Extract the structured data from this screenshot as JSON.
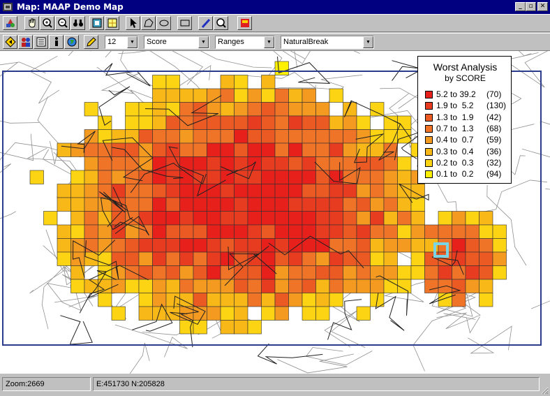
{
  "window": {
    "title": "Map: MAAP Demo Map",
    "minimize": "_",
    "restore": "▫",
    "close": "✕"
  },
  "toolbar1": {
    "icons": [
      "layers-icon",
      "hand-pan-icon",
      "zoom-in-icon",
      "zoom-out-icon",
      "binoculars-icon",
      "map-extent-icon",
      "grid-icon",
      "pointer-icon",
      "polygon-icon",
      "ellipse-icon",
      "rectangle-icon",
      "pen-icon",
      "magnify-icon",
      "flag-icon"
    ]
  },
  "toolbar2": {
    "icons": [
      "navigate-icon",
      "people-icon",
      "list-icon",
      "info-icon",
      "globe-icon",
      "pencil-icon"
    ],
    "combo_count": "12",
    "combo_field": "Score",
    "combo_method": "Ranges",
    "combo_break": "NaturalBreak"
  },
  "legend": {
    "title": "Worst Analysis",
    "subtitle": "by SCORE",
    "items": [
      {
        "range": "5.2 to 39.2",
        "count": "(70)",
        "color": "#e8201c"
      },
      {
        "range": "1.9 to  5.2",
        "count": "(130)",
        "color": "#e83c20"
      },
      {
        "range": "1.3 to  1.9",
        "count": "(42)",
        "color": "#ec5a24"
      },
      {
        "range": "0.7 to  1.3",
        "count": "(68)",
        "color": "#f07428"
      },
      {
        "range": "0.4 to  0.7",
        "count": "(59)",
        "color": "#f49a20"
      },
      {
        "range": "0.3 to  0.4",
        "count": "(36)",
        "color": "#f8b818"
      },
      {
        "range": "0.2 to  0.3",
        "count": "(32)",
        "color": "#fcd414"
      },
      {
        "range": "0.1 to  0.2",
        "count": "(94)",
        "color": "#fff000"
      }
    ]
  },
  "status": {
    "zoom": "Zoom:2669",
    "coords": "E:451730 N:205828"
  },
  "colors": {
    "frame": "#2c3c8c",
    "selection": "#7ad4e4"
  }
}
